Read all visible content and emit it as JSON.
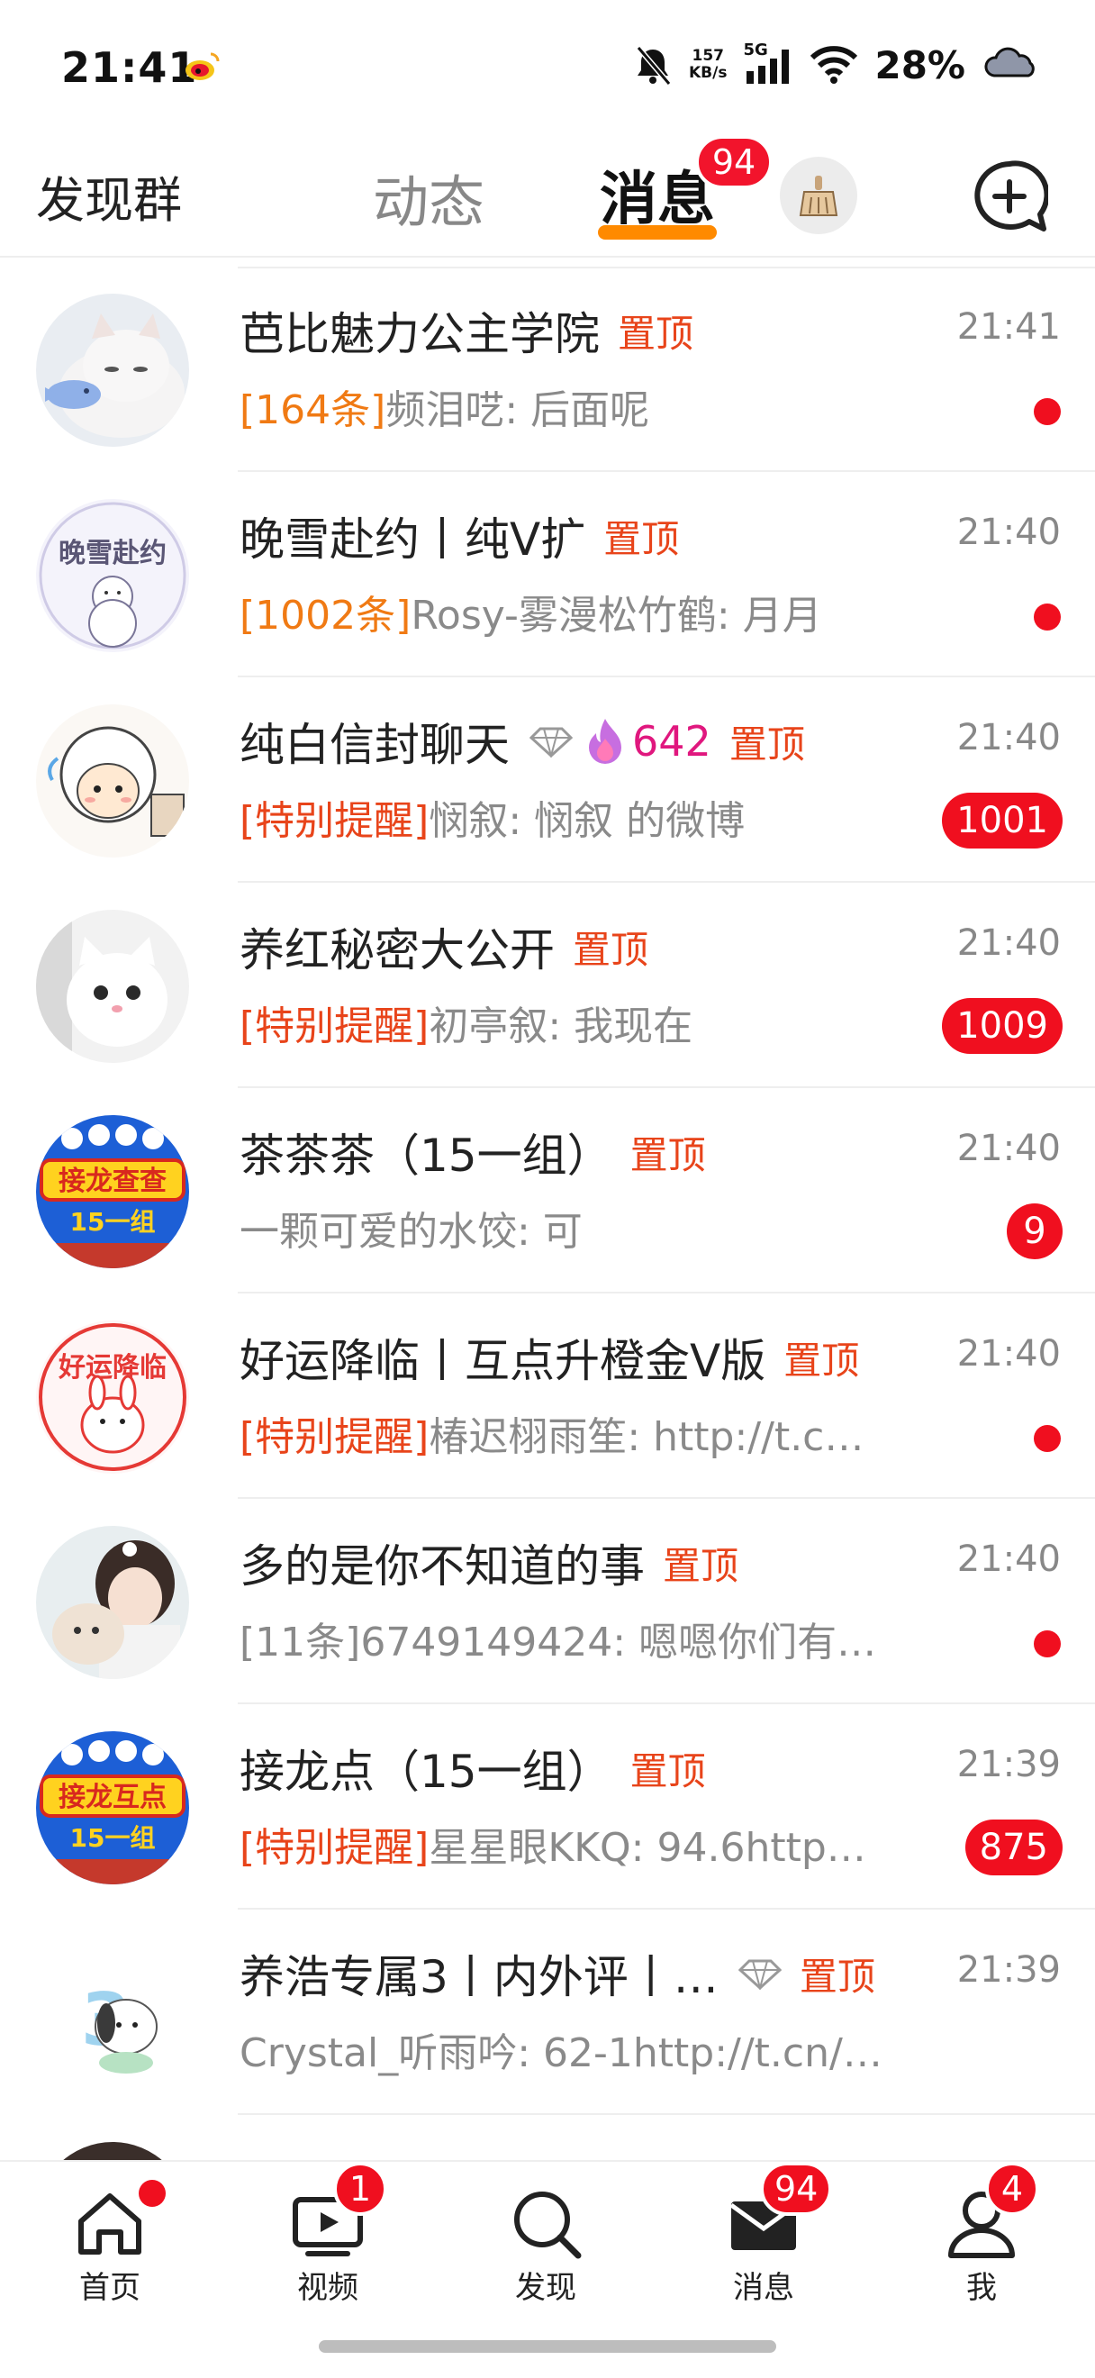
{
  "status_bar": {
    "time": "21:41",
    "net_speed_value": "157",
    "net_speed_unit": "KB/s",
    "network": "5G",
    "battery": "28%",
    "icons": [
      "weibo-logo-icon",
      "mute-bell-icon",
      "signal-icon",
      "wifi-icon",
      "cloud-icon"
    ]
  },
  "top_nav": {
    "discover_groups": "发现群",
    "dynamic": "动态",
    "messages": "消息",
    "messages_badge": "94",
    "active_underline_color": "#ff8a00",
    "icons": [
      "clean-broom-icon",
      "compose-chat-icon"
    ]
  },
  "messages": [
    {
      "title": "芭比魅力公主学院",
      "pinned_label": "置顶",
      "time": "21:41",
      "tag": "[164条]",
      "tag_style": "orange",
      "preview": "频泪呓: 后面呢",
      "indicator": "dot",
      "avatar": "kitten-avatar"
    },
    {
      "title": "晚雪赴约丨纯V扩",
      "pinned_label": "置顶",
      "time": "21:40",
      "tag": "[1002条]",
      "tag_style": "orange",
      "preview": "Rosy-雾漫松竹鹤: 月月",
      "indicator": "dot",
      "avatar": "snowman-sketch-avatar"
    },
    {
      "title": "纯白信封聊天",
      "pinned_label": "置顶",
      "fire_count": "642",
      "has_diamond": true,
      "time": "21:40",
      "tag": "[特别提醒]",
      "tag_style": "red",
      "preview": "悯叙: 悯叙 的微博",
      "indicator": "count",
      "count": "1001",
      "avatar": "sheep-cartoon-avatar"
    },
    {
      "title": "养红秘密大公开",
      "pinned_label": "置顶",
      "time": "21:40",
      "tag": "[特别提醒]",
      "tag_style": "red",
      "preview": "初亭叙: 我现在",
      "indicator": "count",
      "count": "1009",
      "avatar": "white-kitten-avatar"
    },
    {
      "title": "茶茶茶（15一组）",
      "pinned_label": "置顶",
      "time": "21:40",
      "tag": "",
      "tag_style": "gray",
      "preview": "一颗可爱的水饺: 可",
      "indicator": "count",
      "count": "9",
      "avatar": "rabbit-blue-badge-avatar",
      "avatar_text": "接龙查查",
      "avatar_subtext": "15一组"
    },
    {
      "title": "好运降临丨互点升橙金V版",
      "pinned_label": "置顶",
      "time": "21:40",
      "tag": "[特别提醒]",
      "tag_style": "red",
      "preview": "椿迟栩雨笙: http://t.c…",
      "indicator": "dot",
      "avatar": "good-luck-rabbit-avatar",
      "avatar_text": "好运降临"
    },
    {
      "title": "多的是你不知道的事",
      "pinned_label": "置顶",
      "time": "21:40",
      "tag": "[11条]",
      "tag_style": "gray",
      "preview": "6749149424: 嗯嗯你们有…",
      "indicator": "dot",
      "avatar": "girl-with-cat-avatar"
    },
    {
      "title": "接龙点（15一组）",
      "pinned_label": "置顶",
      "time": "21:39",
      "tag": "[特别提醒]",
      "tag_style": "red",
      "preview": "星星眼KKQ: 94.6http…",
      "indicator": "count",
      "count": "875",
      "avatar": "rabbit-blue-badge-avatar",
      "avatar_text": "接龙互点",
      "avatar_subtext": "15一组"
    },
    {
      "title": "养浩专属3丨内外评丨…",
      "pinned_label": "置顶",
      "has_diamond": true,
      "time": "21:39",
      "tag": "",
      "tag_style": "gray",
      "preview": "Crystal_听雨吟: 62-1http://t.cn/…",
      "indicator": "none",
      "avatar": "pochacco-avatar"
    }
  ],
  "tab_bar": {
    "tabs": [
      {
        "label": "首页",
        "icon": "home-icon",
        "badge": "",
        "dot": true
      },
      {
        "label": "视频",
        "icon": "video-icon",
        "badge": "1",
        "dot": false
      },
      {
        "label": "发现",
        "icon": "search-icon",
        "badge": "",
        "dot": false
      },
      {
        "label": "消息",
        "icon": "envelope-icon",
        "badge": "94",
        "dot": false
      },
      {
        "label": "我",
        "icon": "profile-icon",
        "badge": "4",
        "dot": false
      }
    ]
  }
}
